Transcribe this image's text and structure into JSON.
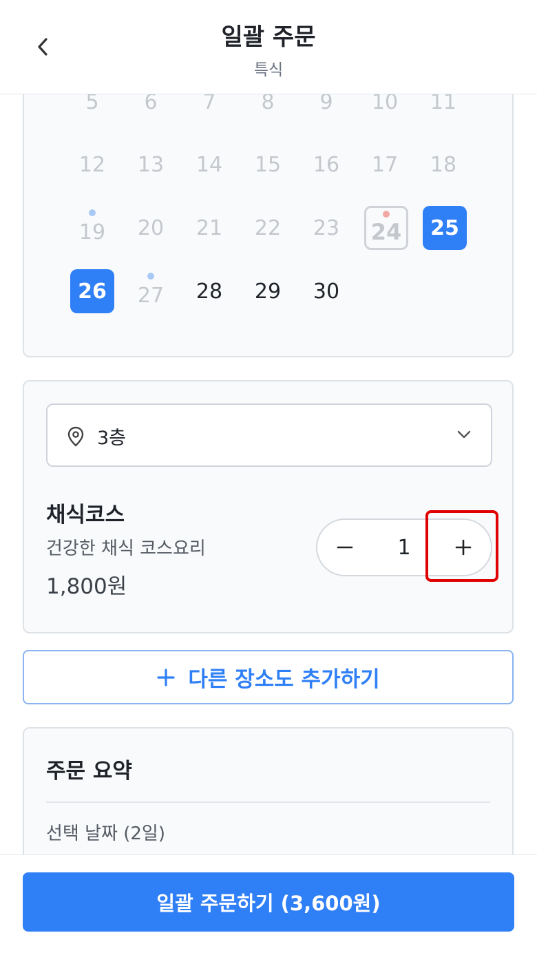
{
  "header": {
    "title": "일괄 주문",
    "subtitle": "특식"
  },
  "calendar": {
    "rows": [
      [
        "5",
        "6",
        "7",
        "8",
        "9",
        "10",
        "11"
      ],
      [
        "12",
        "13",
        "14",
        "15",
        "16",
        "17",
        "18"
      ],
      [
        "19",
        "20",
        "21",
        "22",
        "23",
        "24",
        "25"
      ],
      [
        "26",
        "27",
        "28",
        "29",
        "30"
      ]
    ]
  },
  "location": {
    "selected": "3층"
  },
  "menu": {
    "name": "채식코스",
    "description": "건강한 채식 코스요리",
    "price": "1,800원",
    "quantity": "1"
  },
  "add_location": {
    "label": "다른 장소도 추가하기"
  },
  "summary": {
    "title": "주문 요약",
    "selected_dates": "선택 날짜 (2일)"
  },
  "footer": {
    "order_label": "일괄 주문하기 (3,600원)"
  },
  "colors": {
    "accent": "#2f7ff6",
    "highlight": "#e00000"
  }
}
